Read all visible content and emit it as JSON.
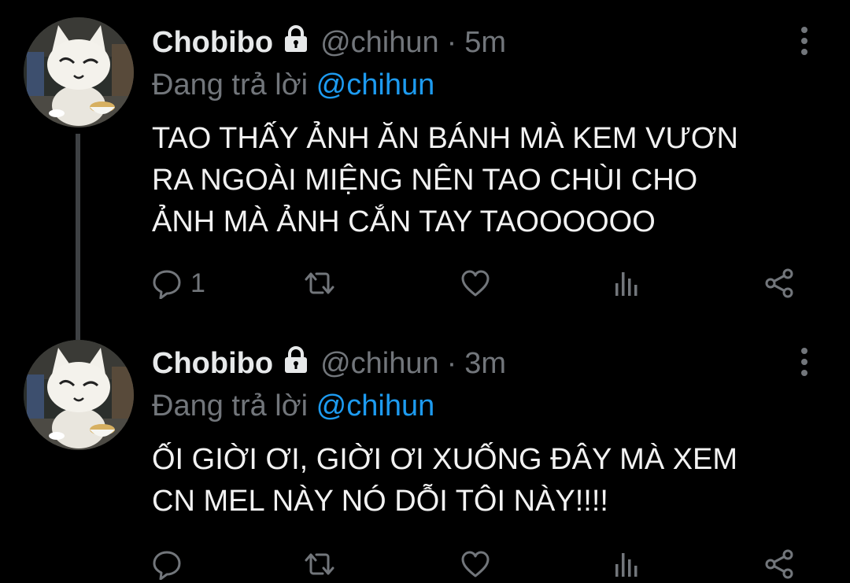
{
  "colors": {
    "background": "#000000",
    "text": "#e7e9ea",
    "secondary": "#72767b",
    "mention": "#1d9bf0",
    "thread_line": "#3e4144"
  },
  "tweets": [
    {
      "display_name": "Chobibo",
      "handle": "@chihun",
      "separator": "·",
      "time": "5m",
      "reply_prefix": "Đang trả lời",
      "reply_to": "@chihun",
      "text": "TAO THẤY ẢNH ĂN BÁNH MÀ KEM VƯƠN\nRA NGOÀI MIỆNG NÊN TAO CHÙI CHO\nẢNH MÀ ẢNH CẮN TAY TAOOOOOO",
      "reply_count": "1",
      "icons": [
        "lock-icon",
        "more-icon",
        "reply-icon",
        "retweet-icon",
        "like-icon",
        "stats-icon",
        "share-icon"
      ]
    },
    {
      "display_name": "Chobibo",
      "handle": "@chihun",
      "separator": "·",
      "time": "3m",
      "reply_prefix": "Đang trả lời",
      "reply_to": "@chihun",
      "text": "ỐI GIỜI ƠI, GIỜI ƠI XUỐNG ĐÂY MÀ XEM\nCN MEL NÀY NÓ DỖI TÔI NÀY!!!!",
      "reply_count": "",
      "icons": [
        "lock-icon",
        "more-icon",
        "reply-icon",
        "retweet-icon",
        "like-icon",
        "stats-icon",
        "share-icon"
      ]
    }
  ]
}
